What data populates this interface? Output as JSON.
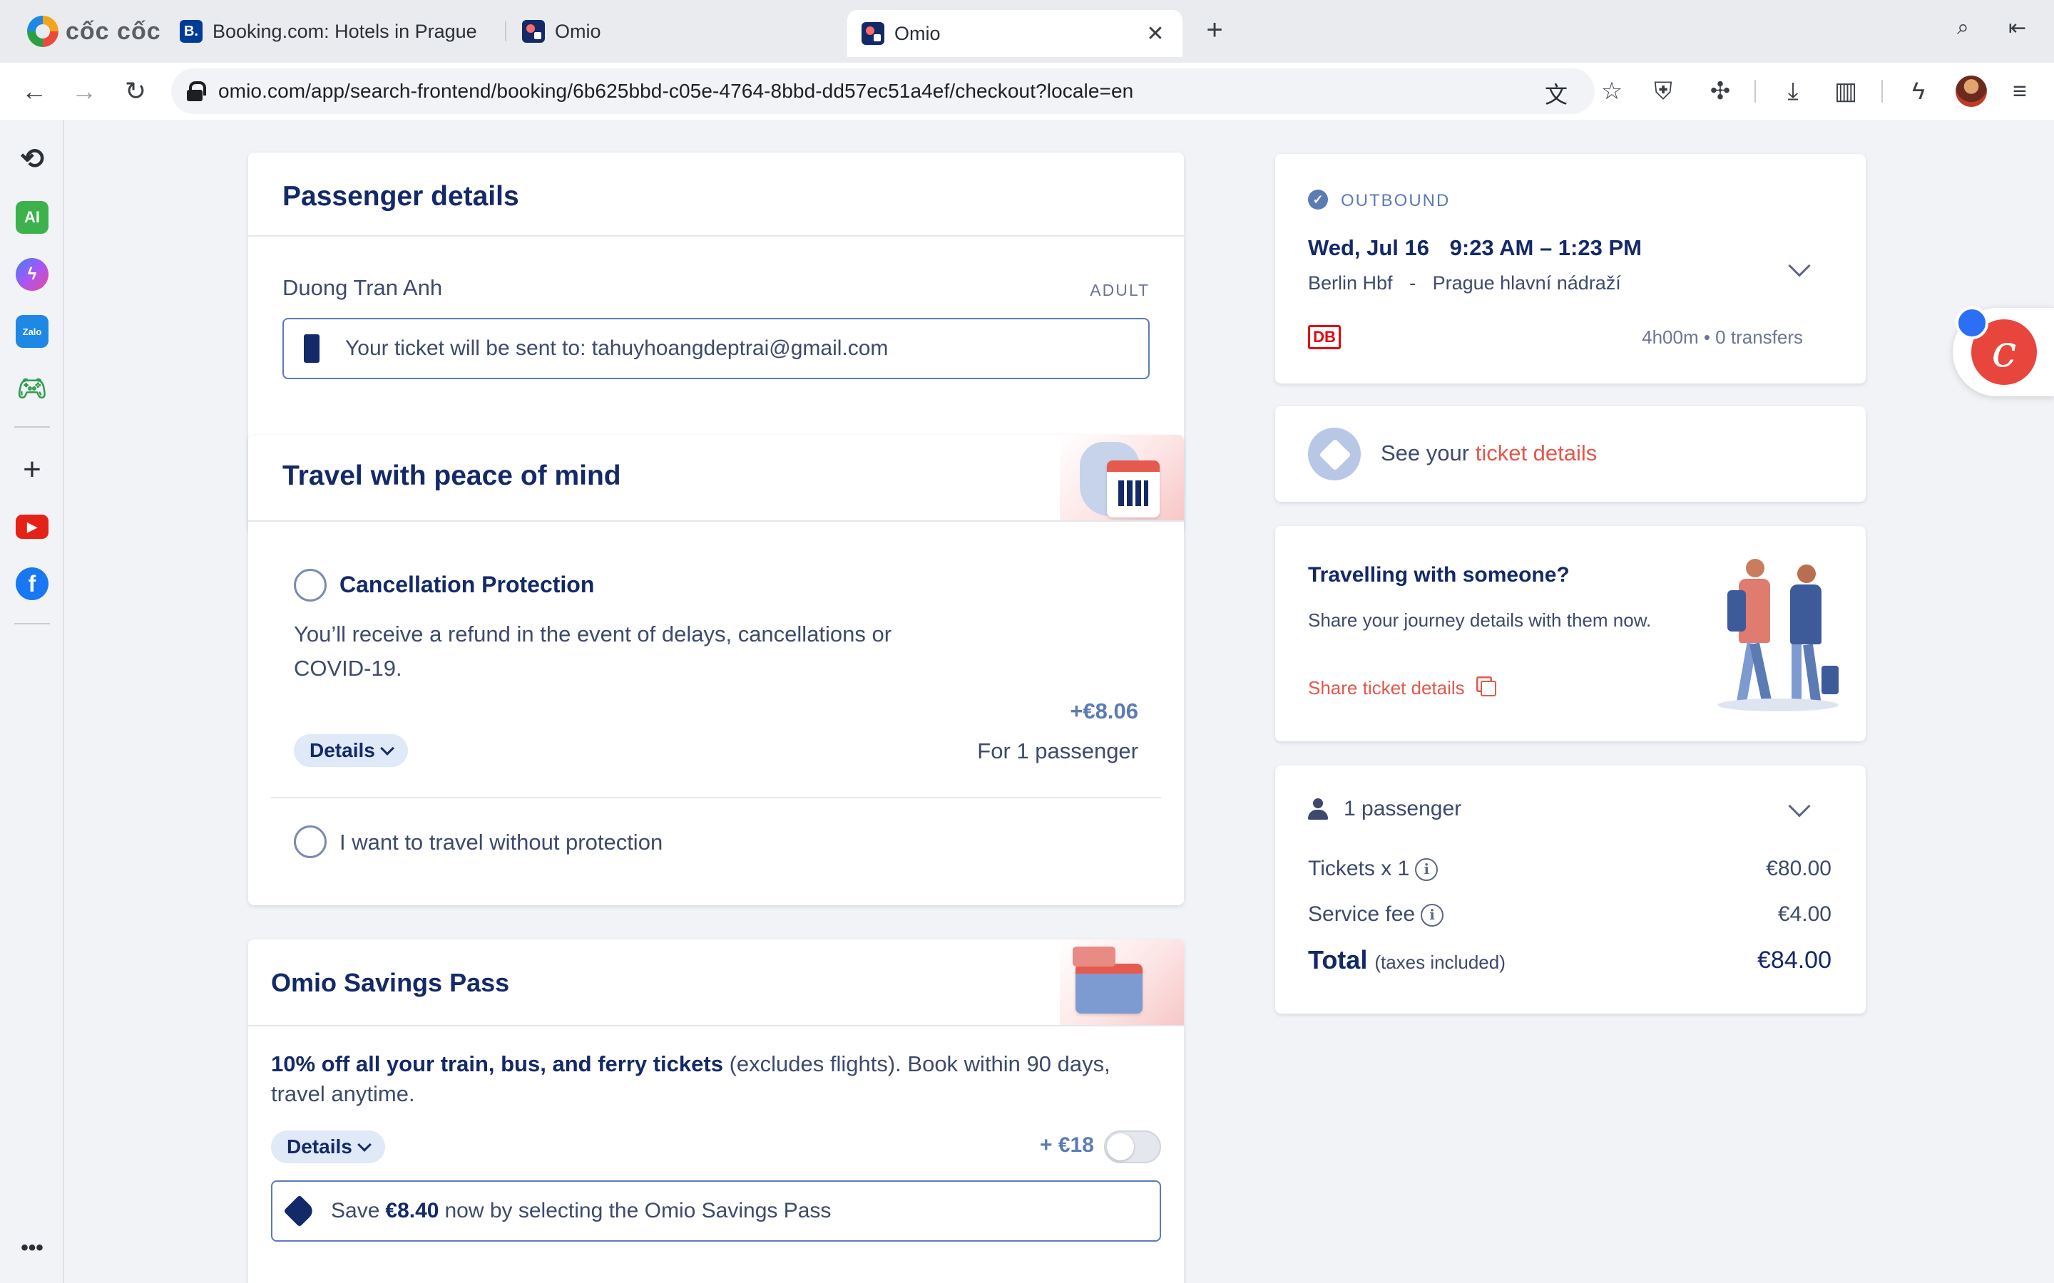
{
  "browser": {
    "brand": "cốc cốc",
    "tabs": [
      {
        "title": "Booking.com: Hotels in Prague",
        "favicon": "B."
      },
      {
        "title": "Omio"
      },
      {
        "title": "Omio",
        "active": true
      }
    ],
    "url": "omio.com/app/search-frontend/booking/6b625bbd-c05e-4764-8bbd-dd57ec51a4ef/checkout?locale=en"
  },
  "sidebar": {
    "items": [
      "history-icon",
      "ai-icon",
      "messenger-icon",
      "zalo-icon",
      "game-icon",
      "add-icon",
      "youtube-icon",
      "facebook-icon",
      "more-icon"
    ],
    "ai_label": "AI",
    "zalo_label": "Zalo"
  },
  "passenger": {
    "heading": "Passenger details",
    "name": "Duong Tran Anh",
    "type": "ADULT",
    "ticket_sent": "Your ticket will be sent to: tahuyhoangdeptrai@gmail.com"
  },
  "protection": {
    "heading": "Travel with peace of mind",
    "option_title": "Cancellation Protection",
    "option_desc": "You’ll receive a refund in the event of delays, cancellations or COVID-19.",
    "price": "+€8.06",
    "price_note": "For 1 passenger",
    "details_label": "Details",
    "no_protection": "I want to travel without protection"
  },
  "savings": {
    "heading": "Omio Savings Pass",
    "desc_bold": "10% off all your train, bus, and ferry tickets",
    "desc_rest": " (excludes flights). Book within 90 days, travel anytime.",
    "details_label": "Details",
    "price": "+ €18",
    "save_prefix": "Save ",
    "save_amount": "€8.40",
    "save_suffix": " now by selecting the Omio Savings Pass"
  },
  "outbound": {
    "label": "OUTBOUND",
    "date": "Wed, Jul 16",
    "time": "9:23 AM – 1:23 PM",
    "from": "Berlin Hbf",
    "sep": "-",
    "to": "Prague hlavní nádraží",
    "operator": "DB",
    "duration": "4h00m • 0 transfers"
  },
  "ticket_details": {
    "prefix": "See your ",
    "link": "ticket details"
  },
  "share": {
    "title": "Travelling with someone?",
    "desc": "Share your journey details with them now.",
    "link": "Share ticket details"
  },
  "price": {
    "passengers": "1 passenger",
    "tickets_label": "Tickets x 1",
    "tickets_value": "€80.00",
    "fee_label": "Service fee",
    "fee_value": "€4.00",
    "total_label": "Total",
    "total_note": "(taxes included)",
    "total_value": "€84.00"
  },
  "colors": {
    "navy": "#132968",
    "accent_red": "#e8453c",
    "link_red": "#e4574b",
    "db_red": "#e30613",
    "pill_blue": "#dfe9f8"
  }
}
